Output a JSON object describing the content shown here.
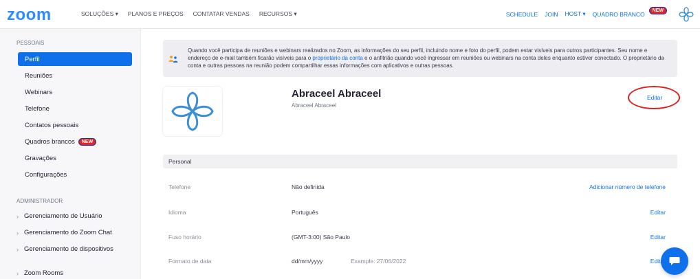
{
  "topnav": {
    "logo": "zoom",
    "left_links": [
      "SOLUÇÕES ▾",
      "PLANOS E PREÇOS",
      "CONTATAR VENDAS",
      "RECURSOS ▾"
    ],
    "schedule": "SCHEDULE",
    "join": "JOIN",
    "host": "HOST ▾",
    "whiteboard": "QUADRO BRANCO",
    "new_badge": "NEW"
  },
  "sidebar": {
    "personal_heading": "PESSOAIS",
    "items": [
      {
        "label": "Perfil"
      },
      {
        "label": "Reuniões"
      },
      {
        "label": "Webinars"
      },
      {
        "label": "Telefone"
      },
      {
        "label": "Contatos pessoais"
      },
      {
        "label": "Quadros brancos",
        "badge": "NEW"
      },
      {
        "label": "Gravações"
      },
      {
        "label": "Configurações"
      }
    ],
    "admin_heading": "ADMINISTRADOR",
    "admin_items": [
      {
        "label": "Gerenciamento de Usuário"
      },
      {
        "label": "Gerenciamento do Zoom Chat"
      },
      {
        "label": "Gerenciamento de dispositivos"
      },
      {
        "label": "Zoom Rooms"
      }
    ]
  },
  "notice": {
    "text_1": "Quando você participa de reuniões e webinars realizados no Zoom, as informações do seu perfil, incluindo nome e foto do perfil, podem estar visíveis para outros participantes. Seu nome e endereço de e-mail também ficarão visíveis para o ",
    "link": "proprietário da conta",
    "text_2": " e o anfitrião quando você ingressar em reuniões ou webinars na conta deles enquanto estiver conectado. O proprietário da conta e outras pessoas na reunião podem compartilhar essas informações com aplicativos e outras pessoas."
  },
  "profile": {
    "name": "Abraceel Abraceel",
    "subtitle": "Abraceel Abraceel",
    "edit_label": "Editar"
  },
  "section": {
    "title": "Personal"
  },
  "rows": [
    {
      "label": "Telefone",
      "value": "Não definida",
      "action": "Adicionar número de telefone"
    },
    {
      "label": "Idioma",
      "value": "Português",
      "action": "Editar"
    },
    {
      "label": "Fuso horário",
      "value": "(GMT-3:00) São Paulo",
      "action": "Editar"
    },
    {
      "label": "Formato de data",
      "value": "dd/mm/yyyy",
      "example": "Example: 27/06/2022",
      "action": "Editar"
    }
  ],
  "colors": {
    "accent": "#0e71eb",
    "badge_red": "#e02828",
    "highlight_circle": "#e02020",
    "flower": "#3a8fd6"
  }
}
